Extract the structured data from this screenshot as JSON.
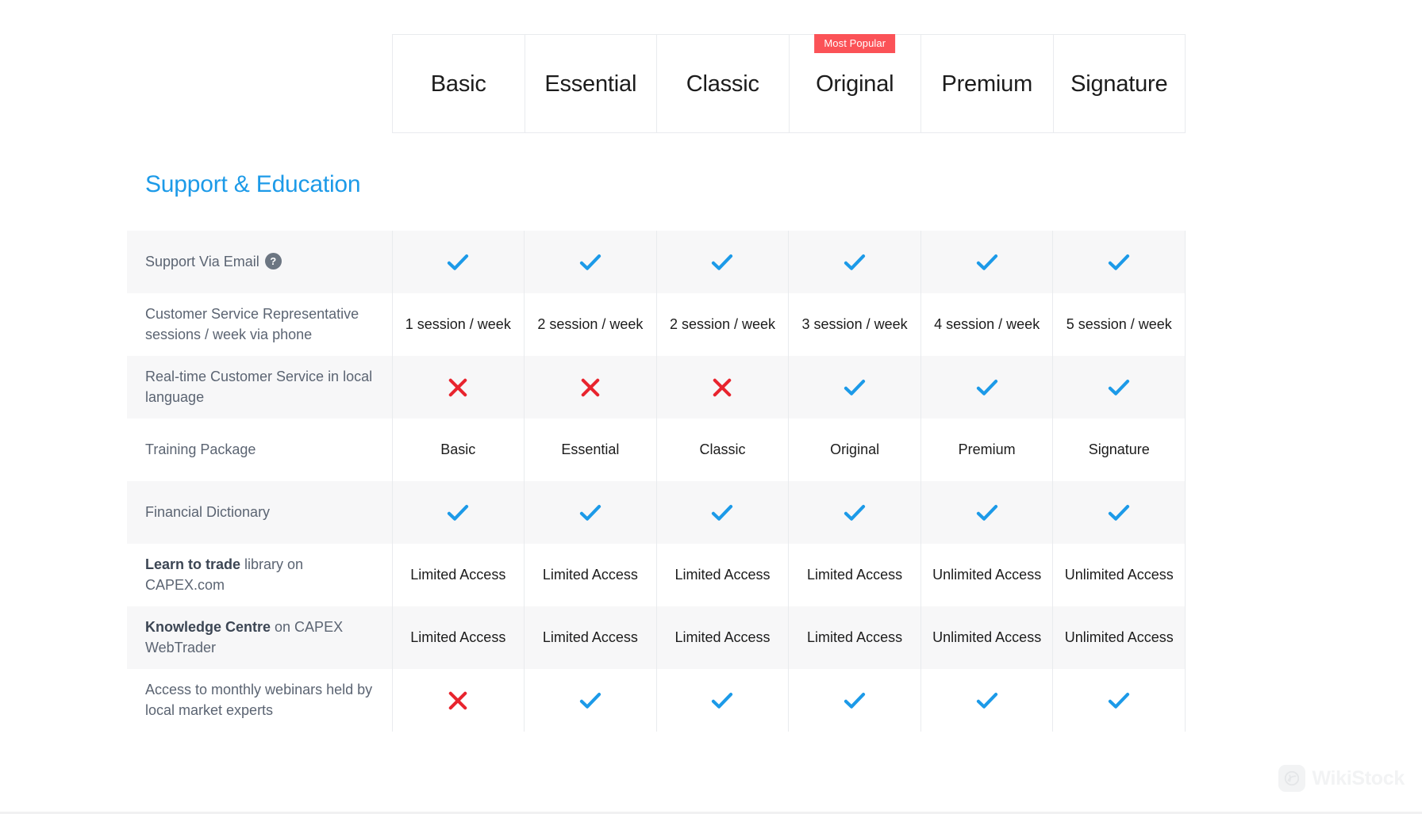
{
  "plans": {
    "popular_badge_label": "Most Popular",
    "popular_index": 3,
    "columns": [
      {
        "name": "Basic"
      },
      {
        "name": "Essential"
      },
      {
        "name": "Classic"
      },
      {
        "name": "Original"
      },
      {
        "name": "Premium"
      },
      {
        "name": "Signature"
      }
    ]
  },
  "section": {
    "title": "Support & Education",
    "title_color": "#1c9ae8"
  },
  "colors": {
    "check": "#1c9ae8",
    "cross": "#e8242e",
    "badge": "#fb5257",
    "help_badge": "#6c7682",
    "row_shaded": "#f7f7f8",
    "border": "#e9ebee"
  },
  "table": {
    "rows": [
      {
        "label": "Support Via Email",
        "label_bold": "",
        "label_rest": "",
        "has_help_icon": true,
        "help_icon_label": "?",
        "shaded": true,
        "values": [
          "check",
          "check",
          "check",
          "check",
          "check",
          "check"
        ]
      },
      {
        "label": "Customer Service Representative sessions / week via phone",
        "label_bold": "",
        "label_rest": "",
        "has_help_icon": false,
        "help_icon_label": "",
        "shaded": false,
        "values": [
          "1 session / week",
          "2 session / week",
          "2 session / week",
          "3 session / week",
          "4 session / week",
          "5 session / week"
        ]
      },
      {
        "label": "Real-time Customer Service in local language",
        "label_bold": "",
        "label_rest": "",
        "has_help_icon": false,
        "help_icon_label": "",
        "shaded": true,
        "values": [
          "cross",
          "cross",
          "cross",
          "check",
          "check",
          "check"
        ]
      },
      {
        "label": "Training Package",
        "label_bold": "",
        "label_rest": "",
        "has_help_icon": false,
        "help_icon_label": "",
        "shaded": false,
        "values": [
          "Basic",
          "Essential",
          "Classic",
          "Original",
          "Premium",
          "Signature"
        ]
      },
      {
        "label": "Financial Dictionary",
        "label_bold": "",
        "label_rest": "",
        "has_help_icon": false,
        "help_icon_label": "",
        "shaded": true,
        "values": [
          "check",
          "check",
          "check",
          "check",
          "check",
          "check"
        ]
      },
      {
        "label": "",
        "label_bold": "Learn to trade",
        "label_rest": " library on CAPEX.com",
        "has_help_icon": false,
        "help_icon_label": "",
        "shaded": false,
        "values": [
          "Limited Access",
          "Limited Access",
          "Limited Access",
          "Limited Access",
          "Unlimited Access",
          "Unlimited Access"
        ]
      },
      {
        "label": "",
        "label_bold": "Knowledge Centre",
        "label_rest": " on CAPEX WebTrader",
        "has_help_icon": false,
        "help_icon_label": "",
        "shaded": true,
        "values": [
          "Limited Access",
          "Limited Access",
          "Limited Access",
          "Limited Access",
          "Unlimited Access",
          "Unlimited Access"
        ]
      },
      {
        "label": "Access to monthly webinars held by local market experts",
        "label_bold": "",
        "label_rest": "",
        "has_help_icon": false,
        "help_icon_label": "",
        "shaded": false,
        "values": [
          "cross",
          "check",
          "check",
          "check",
          "check",
          "check"
        ]
      }
    ]
  },
  "watermark": {
    "text": "WikiStock"
  }
}
